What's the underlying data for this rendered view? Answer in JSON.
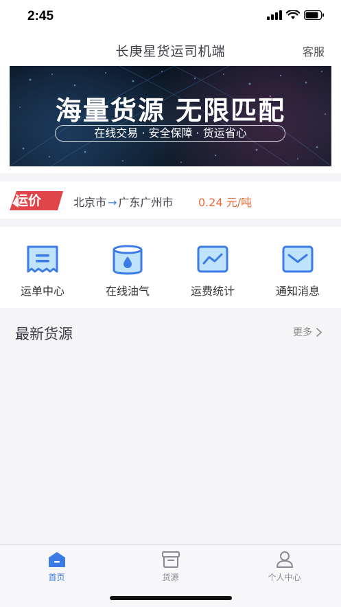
{
  "status_bar": {
    "time": "2:45"
  },
  "nav": {
    "title": "长庚星货运司机端",
    "service": "客服"
  },
  "banner": {
    "title": "海量货源 无限匹配",
    "subtitle": "在线交易 · 安全保障 · 货运省心"
  },
  "price": {
    "badge": "运价",
    "from": "北京市",
    "arrow": "→",
    "to": "广东广州市",
    "value": "0.24 元/吨"
  },
  "menu": [
    {
      "label": "运单中心",
      "icon": "waybill-icon"
    },
    {
      "label": "在线油气",
      "icon": "fuel-icon"
    },
    {
      "label": "运费统计",
      "icon": "chart-icon"
    },
    {
      "label": "通知消息",
      "icon": "mail-icon"
    }
  ],
  "section": {
    "title": "最新货源",
    "more": "更多"
  },
  "tabs": [
    {
      "label": "首页",
      "icon": "home-icon",
      "active": true
    },
    {
      "label": "货源",
      "icon": "cargo-icon",
      "active": false
    },
    {
      "label": "个人中心",
      "icon": "user-icon",
      "active": false
    }
  ],
  "colors": {
    "accent": "#3b7be6",
    "price": "#e86a36",
    "badge": "#e0454a"
  }
}
